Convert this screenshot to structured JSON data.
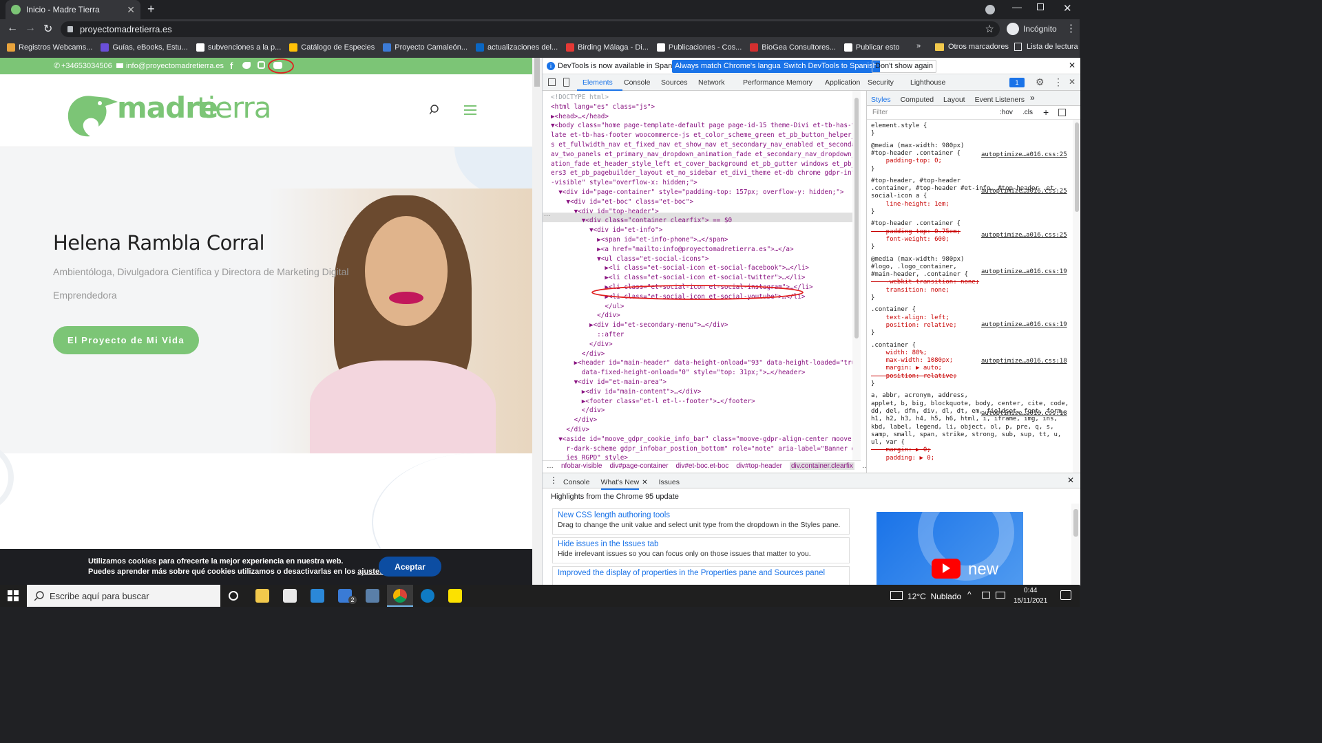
{
  "browser": {
    "tab_title": "Inicio - Madre Tierra",
    "url": "proyectomadretierra.es",
    "profile_label": "Incógnito",
    "bookmarks": [
      "Registros Webcams...",
      "Guías, eBooks, Estu...",
      "subvenciones a la p...",
      "Catálogo de Especies",
      "Proyecto Camaleón...",
      "actualizaciones del...",
      "Birding Málaga - Di...",
      "Publicaciones - Cos...",
      "BioGea Consultores...",
      "Publicar esto"
    ],
    "other_bookmarks": "Otros marcadores",
    "reading_list": "Lista de lectura",
    "bookmark_colors": [
      "#e8a33c",
      "#6a4fd8",
      "#ffffff",
      "#ffc107",
      "#3c7bd6",
      "#0a66c2",
      "#e53935",
      "#ffffff",
      "#d32f2f",
      "#ffffff"
    ]
  },
  "site": {
    "phone": "+34653034506",
    "email": "info@proyectomadretierra.es",
    "logo_text_1": "madre",
    "logo_text_2": "tierra",
    "hero_name": "Helena Rambla Corral",
    "hero_subtitle_1": "Ambientóloga, Divulgadora Científica y Directora de Marketing Digital",
    "hero_subtitle_2": "Emprendedora",
    "hero_button": "El Proyecto de Mi Vida",
    "cookie_line_1": "Utilizamos cookies para ofrecerte la mejor experiencia en nuestra web.",
    "cookie_line_2": "Puedes aprender más sobre qué cookies utilizamos o desactivarlas en los ",
    "cookie_link": "ajustes",
    "cookie_accept": "Aceptar",
    "brand_green": "#7cc576"
  },
  "devtools": {
    "banner_text": "DevTools is now available in Spanish!",
    "banner_btn_1": "Always match Chrome's language",
    "banner_btn_2": "Switch DevTools to Spanish",
    "banner_btn_3": "Don't show again",
    "main_tabs": [
      "Elements",
      "Console",
      "Sources",
      "Network",
      "Performance",
      "Memory",
      "Application",
      "Security",
      "Lighthouse"
    ],
    "issues_count": "1",
    "styles_tabs": [
      "Styles",
      "Computed",
      "Layout",
      "Event Listeners"
    ],
    "filter_placeholder": "Filter",
    "hov": ":hov",
    "cls": ".cls",
    "dom_lines": [
      "<!DOCTYPE html>",
      "<html lang=\"es\" class=\"js\">",
      "▶<head>…</head>",
      "▼<body class=\"home page-template-default page page-id-15 theme-Divi et-tb-has-temp",
      "late et-tb-has-footer woocommerce-js et_color_scheme_green et_pb_button_helper_clas",
      "s et_fullwidth_nav et_fixed_nav et_show_nav et_secondary_nav_enabled et_secondary_n",
      "av_two_panels et_primary_nav_dropdown_animation_fade et_secondary_nav_dropdown_anim",
      "ation_fade et_header_style_left et_cover_background et_pb_gutter windows et_pb_gutt",
      "ers3 et_pb_pagebuilder_layout et_no_sidebar et_divi_theme et-db chrome gdpr-infobar",
      "-visible\" style=\"overflow-x: hidden;\">",
      "  ▼<div id=\"page-container\" style=\"padding-top: 157px; overflow-y: hidden;\">",
      "    ▼<div id=\"et-boc\" class=\"et-boc\">",
      "      ▼<div id=\"top-header\">",
      "        ▼<div class=\"container clearfix\"> == $0",
      "          ▼<div id=\"et-info\">",
      "            ▶<span id=\"et-info-phone\">…</span>",
      "            ▶<a href=\"mailto:info@proyectomadretierra.es\">…</a>",
      "            ▼<ul class=\"et-social-icons\">",
      "              ▶<li class=\"et-social-icon et-social-facebook\">…</li>",
      "              ▶<li class=\"et-social-icon et-social-twitter\">…</li>",
      "              ▶<li class=\"et-social-icon et-social-instagram\">…</li>",
      "              ▶<li class=\"et-social-icon et-social-youtube\">…</li>",
      "              </ul>",
      "            </div>",
      "          ▶<div id=\"et-secondary-menu\">…</div>",
      "            ::after",
      "          </div>",
      "        </div>",
      "      ▶<header id=\"main-header\" data-height-onload=\"93\" data-height-loaded=\"true\"",
      "        data-fixed-height-onload=\"0\" style=\"top: 31px;\">…</header>",
      "      ▼<div id=\"et-main-area\">",
      "        ▶<div id=\"main-content\">…</div>",
      "        ▶<footer class=\"et-l et-l--footer\">…</footer>",
      "        </div>",
      "      </div>",
      "    </div>",
      "  ▼<aside id=\"moove_gdpr_cookie_info_bar\" class=\"moove-gdpr-align-center moove-gdp",
      "    r-dark-scheme gdpr_infobar_postion_bottom\" role=\"note\" aria-label=\"Banner de cook",
      "    ies RGPD\" style>"
    ],
    "breadcrumbs": [
      "…",
      "nfobar-visible",
      "div#page-container",
      "div#et-boc.et-boc",
      "div#top-header",
      "div.container.clearfix",
      "…"
    ],
    "style_lines": [
      "element.style {",
      "}",
      "@media (max-width: 980px)",
      "#top-header .container {",
      "    padding-top: 0;",
      "}",
      "#top-header, #top-header",
      ".container, #top-header #et-info, #top-header .et-",
      "social-icon a {",
      "    line-height: 1em;",
      "}",
      "#top-header .container {",
      "    padding-top: 0.75em;",
      "    font-weight: 600;",
      "}",
      "@media (max-width: 980px)",
      "#logo, .logo_container,",
      "#main-header, .container {",
      "    -webkit-transition: none;",
      "    transition: none;",
      "}",
      ".container {",
      "    text-align: left;",
      "    position: relative;",
      "}",
      ".container {",
      "    width: 80%;",
      "    max-width: 1080px;",
      "    margin: ▶ auto;",
      "    position: relative;",
      "}",
      "a, abbr, acronym, address,",
      "applet, b, big, blockquote, body, center, cite, code,",
      "dd, del, dfn, div, dl, dt, em, fieldset, font, form,",
      "h1, h2, h3, h4, h5, h6, html, i, iframe, img, ins,",
      "kbd, label, legend, li, object, ol, p, pre, q, s,",
      "samp, small, span, strike, strong, sub, sup, tt, u,",
      "ul, var {",
      "    margin: ▶ 0;",
      "    padding: ▶ 0;"
    ],
    "style_sources": [
      "autoptimize…a016.css:25",
      "autoptimize…a016.css:25",
      "autoptimize…a016.css:25",
      "autoptimize…a016.css:19",
      "autoptimize…a016.css:19",
      "autoptimize…a016.css:18",
      "autoptimize…a016.css:18"
    ],
    "drawer_tabs": [
      "Console",
      "What's New",
      "Issues"
    ],
    "drawer_heading": "Highlights from the Chrome 95 update",
    "whatsnew": [
      {
        "title": "New CSS length authoring tools",
        "desc": "Drag to change the unit value and select unit type from the dropdown in the Styles pane."
      },
      {
        "title": "Hide issues in the Issues tab",
        "desc": "Hide irrelevant issues so you can focus only on those issues that matter to you."
      },
      {
        "title": "Improved the display of properties in the Properties pane and Sources panel",
        "desc": ""
      }
    ],
    "video_label": "new"
  },
  "taskbar": {
    "search_placeholder": "Escribe aquí para buscar",
    "weather": "12°C  Nublado",
    "time": "0:44",
    "date": "15/11/2021",
    "badge": "2"
  }
}
